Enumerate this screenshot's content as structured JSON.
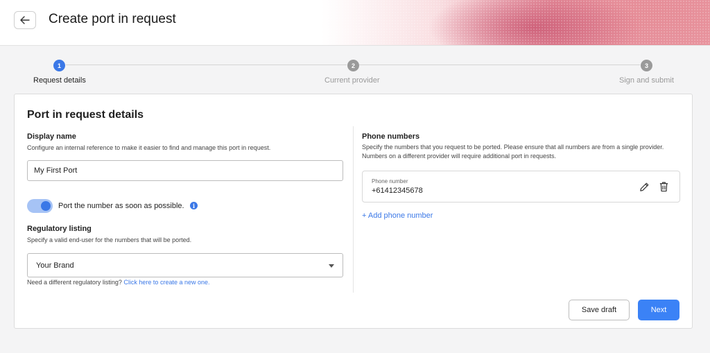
{
  "header": {
    "title": "Create port in request"
  },
  "stepper": {
    "steps": [
      {
        "number": "1",
        "label": "Request details"
      },
      {
        "number": "2",
        "label": "Current provider"
      },
      {
        "number": "3",
        "label": "Sign and submit"
      }
    ],
    "active_color": "#3b78e7",
    "inactive_color": "#9a9a9a"
  },
  "form": {
    "title": "Port in request details",
    "display_name": {
      "label": "Display name",
      "help": "Configure an internal reference to make it easier to find and manage this port in request.",
      "value": "My First Port"
    },
    "asap_toggle": {
      "label": "Port the number as soon as possible.",
      "checked": true
    },
    "regulatory": {
      "label": "Regulatory listing",
      "help": "Specify a valid end-user for the numbers that will be ported.",
      "value": "Your Brand",
      "note": "Need a different regulatory listing? ",
      "link": "Click here to create a new one."
    },
    "phone_numbers": {
      "label": "Phone numbers",
      "help": "Specify the numbers that you request to be ported. Please ensure that all numbers are from a single provider. Numbers on a different provider will require additional port in requests.",
      "items": [
        {
          "field_label": "Phone number",
          "value": "+61412345678"
        }
      ],
      "add_label": "+ Add phone number"
    },
    "actions": {
      "save_draft": "Save draft",
      "next": "Next"
    }
  },
  "colors": {
    "accent": "#3b78e7",
    "next_button": "#3b82f6"
  },
  "icons": {
    "back": "arrow-left-icon",
    "edit": "pencil-icon",
    "delete": "trash-icon",
    "info": "info-icon",
    "dropdown": "chevron-down-icon"
  }
}
